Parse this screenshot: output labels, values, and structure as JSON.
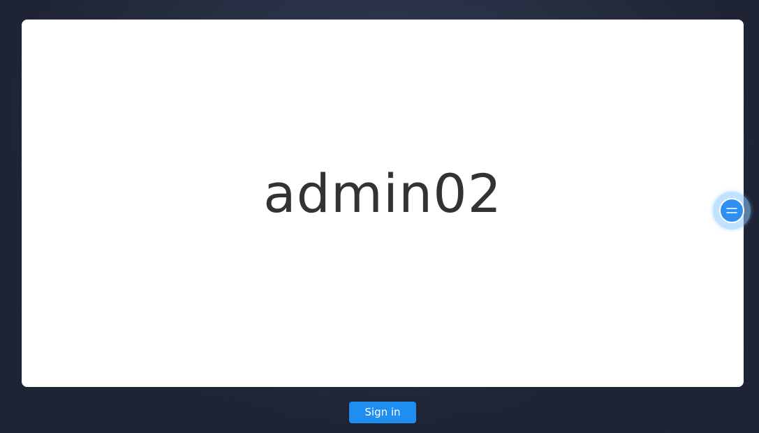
{
  "login": {
    "username": "admin02",
    "sign_in_label": "Sign in"
  },
  "floating_assist": {
    "icon": "menu-lines-icon"
  },
  "colors": {
    "background": "#1e2436",
    "card": "#ffffff",
    "username_text": "#333333",
    "button": "#1f8ef1",
    "float_ball": "#2f8ff0"
  }
}
